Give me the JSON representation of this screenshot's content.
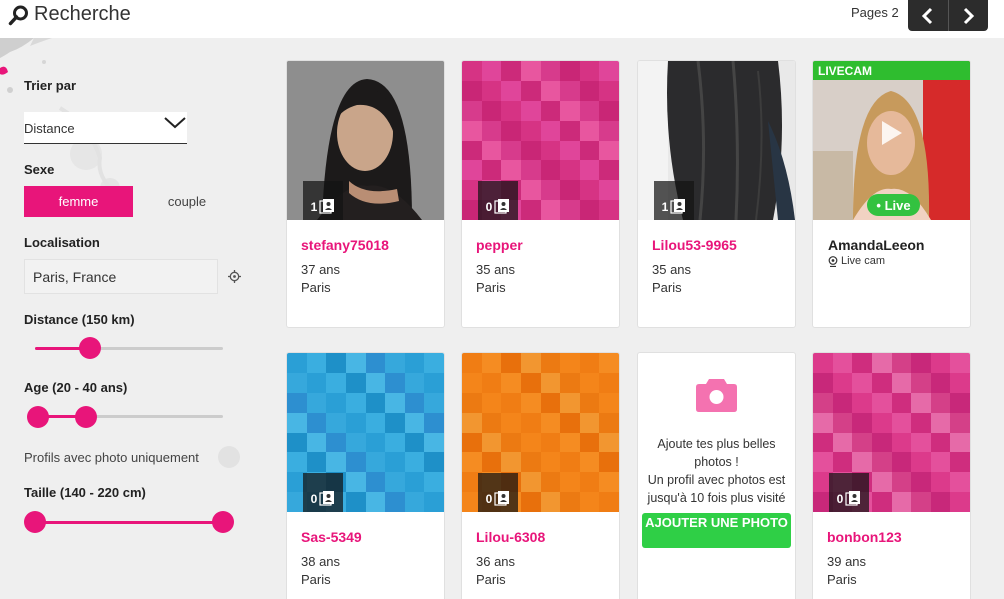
{
  "header": {
    "title": "Recherche",
    "pages_label": "Pages 2"
  },
  "sidebar": {
    "sort_label": "Trier par",
    "sort_value": "Distance",
    "sex_label": "Sexe",
    "sex_options": [
      "femme",
      "couple"
    ],
    "sex_selected": "femme",
    "location_label": "Localisation",
    "location_value": "Paris, France",
    "distance": {
      "label": "Distance (150 km)",
      "value": 150
    },
    "age": {
      "label": "Age (20 - 40 ans)",
      "range": [
        20,
        40
      ]
    },
    "photo_only": {
      "label": "Profils avec photo uniquement",
      "enabled": false
    },
    "height": {
      "label": "Taille (140 - 220 cm)",
      "range": [
        140,
        220
      ]
    }
  },
  "cards": [
    {
      "name": "stefany75018",
      "age": "37 ans",
      "city": "Paris",
      "photos": "1"
    },
    {
      "name": "pepper",
      "age": "35 ans",
      "city": "Paris",
      "photos": "0"
    },
    {
      "name": "Lilou53-9965",
      "age": "35 ans",
      "city": "Paris",
      "photos": "1"
    },
    {
      "name": "Sas-5349",
      "age": "38 ans",
      "city": "Paris",
      "photos": "0"
    },
    {
      "name": "Lilou-6308",
      "age": "36 ans",
      "city": "Paris",
      "photos": "0"
    },
    {
      "name": "bonbon123",
      "age": "39 ans",
      "city": "Paris",
      "photos": "0"
    }
  ],
  "live_card": {
    "tag": "LIVECAM",
    "pill": "• Live",
    "name": "AmandaLeeon",
    "sub": "Live cam"
  },
  "promo_card": {
    "text_line1": "Ajoute tes plus belles photos !",
    "text_line2": "Un profil avec photos est jusqu'à 10 fois plus visité",
    "button": "AJOUTER UNE PHOTO"
  },
  "colors": {
    "accent": "#e8157a",
    "live_green": "#2fbd2f",
    "cta_green": "#2fcf46"
  },
  "icons": [
    "search-icon",
    "chevron-left-icon",
    "chevron-right-icon",
    "chevron-down-icon",
    "target-icon",
    "photo-count-icon",
    "camera-icon",
    "play-icon",
    "webcam-icon"
  ]
}
